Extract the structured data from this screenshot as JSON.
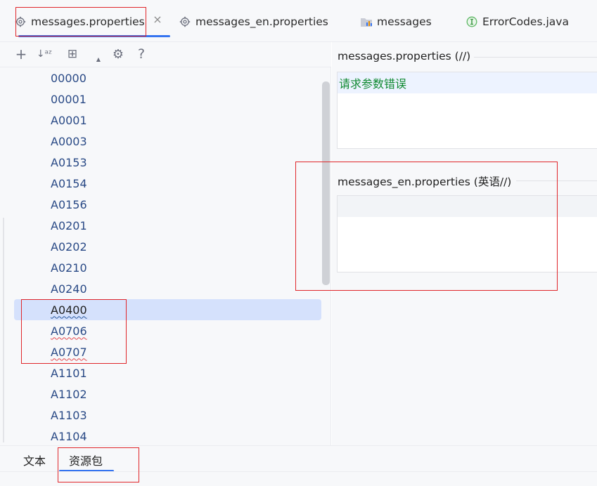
{
  "tabs": [
    {
      "label": "messages.properties",
      "icon": "gear-icon",
      "active": true
    },
    {
      "label": "messages_en.properties",
      "icon": "gear-icon",
      "active": false
    },
    {
      "label": "messages",
      "icon": "resource-bundle-icon",
      "active": false
    },
    {
      "label": "ErrorCodes.java",
      "icon": "interface-icon",
      "active": false
    }
  ],
  "tab_close_glyph": "×",
  "toolbar": {
    "add": "+",
    "sort": "↓ᵃᶻ",
    "group": "⊞",
    "settings": "⚙",
    "help": "?"
  },
  "keys": [
    "00000",
    "00001",
    "A0001",
    "A0003",
    "A0153",
    "A0154",
    "A0156",
    "A0201",
    "A0202",
    "A0210",
    "A0240",
    "A0400",
    "A0706",
    "A0707",
    "A1101",
    "A1102",
    "A1103",
    "A1104"
  ],
  "selected_key": "A0400",
  "right": {
    "section1_title": "messages.properties (//)",
    "section1_value": "请求参数错误",
    "section2_title": "messages_en.properties (英语//)",
    "section2_value": ""
  },
  "bottom_tabs": [
    {
      "label": "文本",
      "active": false
    },
    {
      "label": "资源包",
      "active": true
    }
  ],
  "colors": {
    "accent": "#3574f0",
    "highlight_box": "#e0262a",
    "key_text": "#2a4a86",
    "value_text": "#108a32",
    "selected_bg": "#d5e1fc"
  }
}
